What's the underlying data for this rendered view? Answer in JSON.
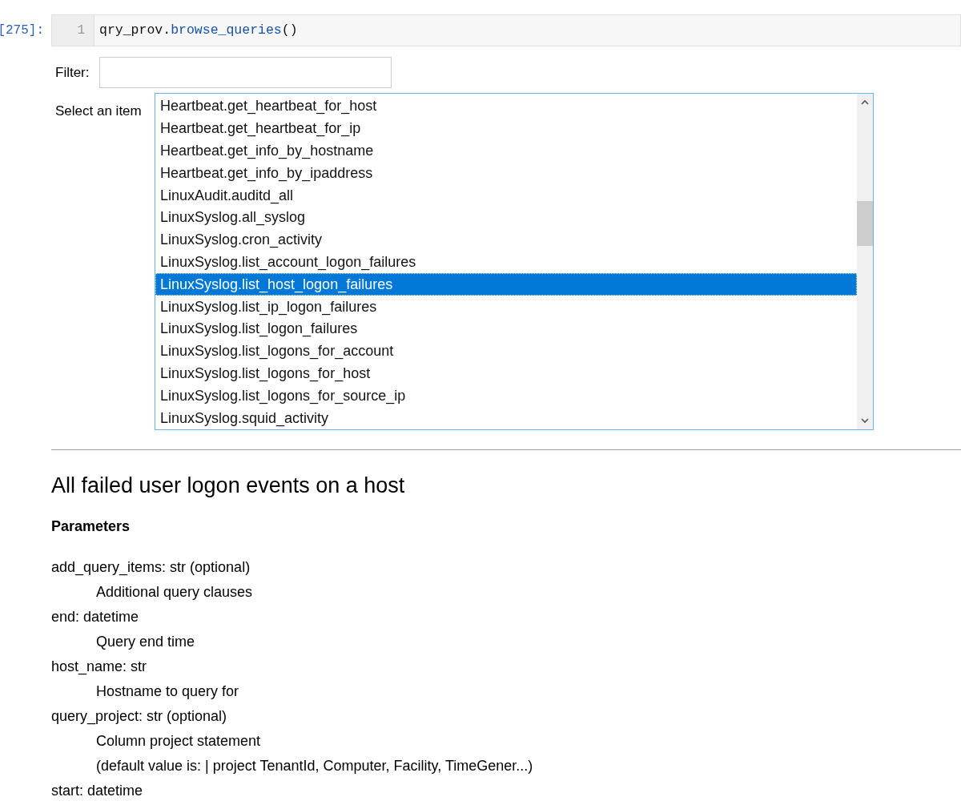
{
  "cell": {
    "prompt": "[275]:",
    "line_number": "1",
    "code": [
      {
        "text": "qry_prov.",
        "kind": "plain"
      },
      {
        "text": "browse_queries",
        "kind": "method"
      },
      {
        "text": "()",
        "kind": "plain"
      }
    ]
  },
  "filter": {
    "label": "Filter:"
  },
  "listbox": {
    "label": "Select an item",
    "items": [
      {
        "label": "Heartbeat.get_heartbeat_for_host",
        "selected": false
      },
      {
        "label": "Heartbeat.get_heartbeat_for_ip",
        "selected": false
      },
      {
        "label": "Heartbeat.get_info_by_hostname",
        "selected": false
      },
      {
        "label": "Heartbeat.get_info_by_ipaddress",
        "selected": false
      },
      {
        "label": "LinuxAudit.auditd_all",
        "selected": false
      },
      {
        "label": "LinuxSyslog.all_syslog",
        "selected": false
      },
      {
        "label": "LinuxSyslog.cron_activity",
        "selected": false
      },
      {
        "label": "LinuxSyslog.list_account_logon_failures",
        "selected": false
      },
      {
        "label": "LinuxSyslog.list_host_logon_failures",
        "selected": true
      },
      {
        "label": "LinuxSyslog.list_ip_logon_failures",
        "selected": false
      },
      {
        "label": "LinuxSyslog.list_logon_failures",
        "selected": false
      },
      {
        "label": "LinuxSyslog.list_logons_for_account",
        "selected": false
      },
      {
        "label": "LinuxSyslog.list_logons_for_host",
        "selected": false
      },
      {
        "label": "LinuxSyslog.list_logons_for_source_ip",
        "selected": false
      },
      {
        "label": "LinuxSyslog.squid_activity",
        "selected": false
      }
    ]
  },
  "doc": {
    "title": "All failed user logon events on a host",
    "section": "Parameters",
    "parameters": [
      {
        "signature": "add_query_items: str (optional)",
        "description": [
          "Additional query clauses"
        ]
      },
      {
        "signature": "end: datetime",
        "description": [
          "Query end time"
        ]
      },
      {
        "signature": "host_name: str",
        "description": [
          "Hostname to query for"
        ]
      },
      {
        "signature": "query_project: str (optional)",
        "description": [
          "Column project statement",
          "(default value is: | project TenantId, Computer, Facility, TimeGener...)"
        ]
      },
      {
        "signature": "start: datetime"
      }
    ]
  }
}
